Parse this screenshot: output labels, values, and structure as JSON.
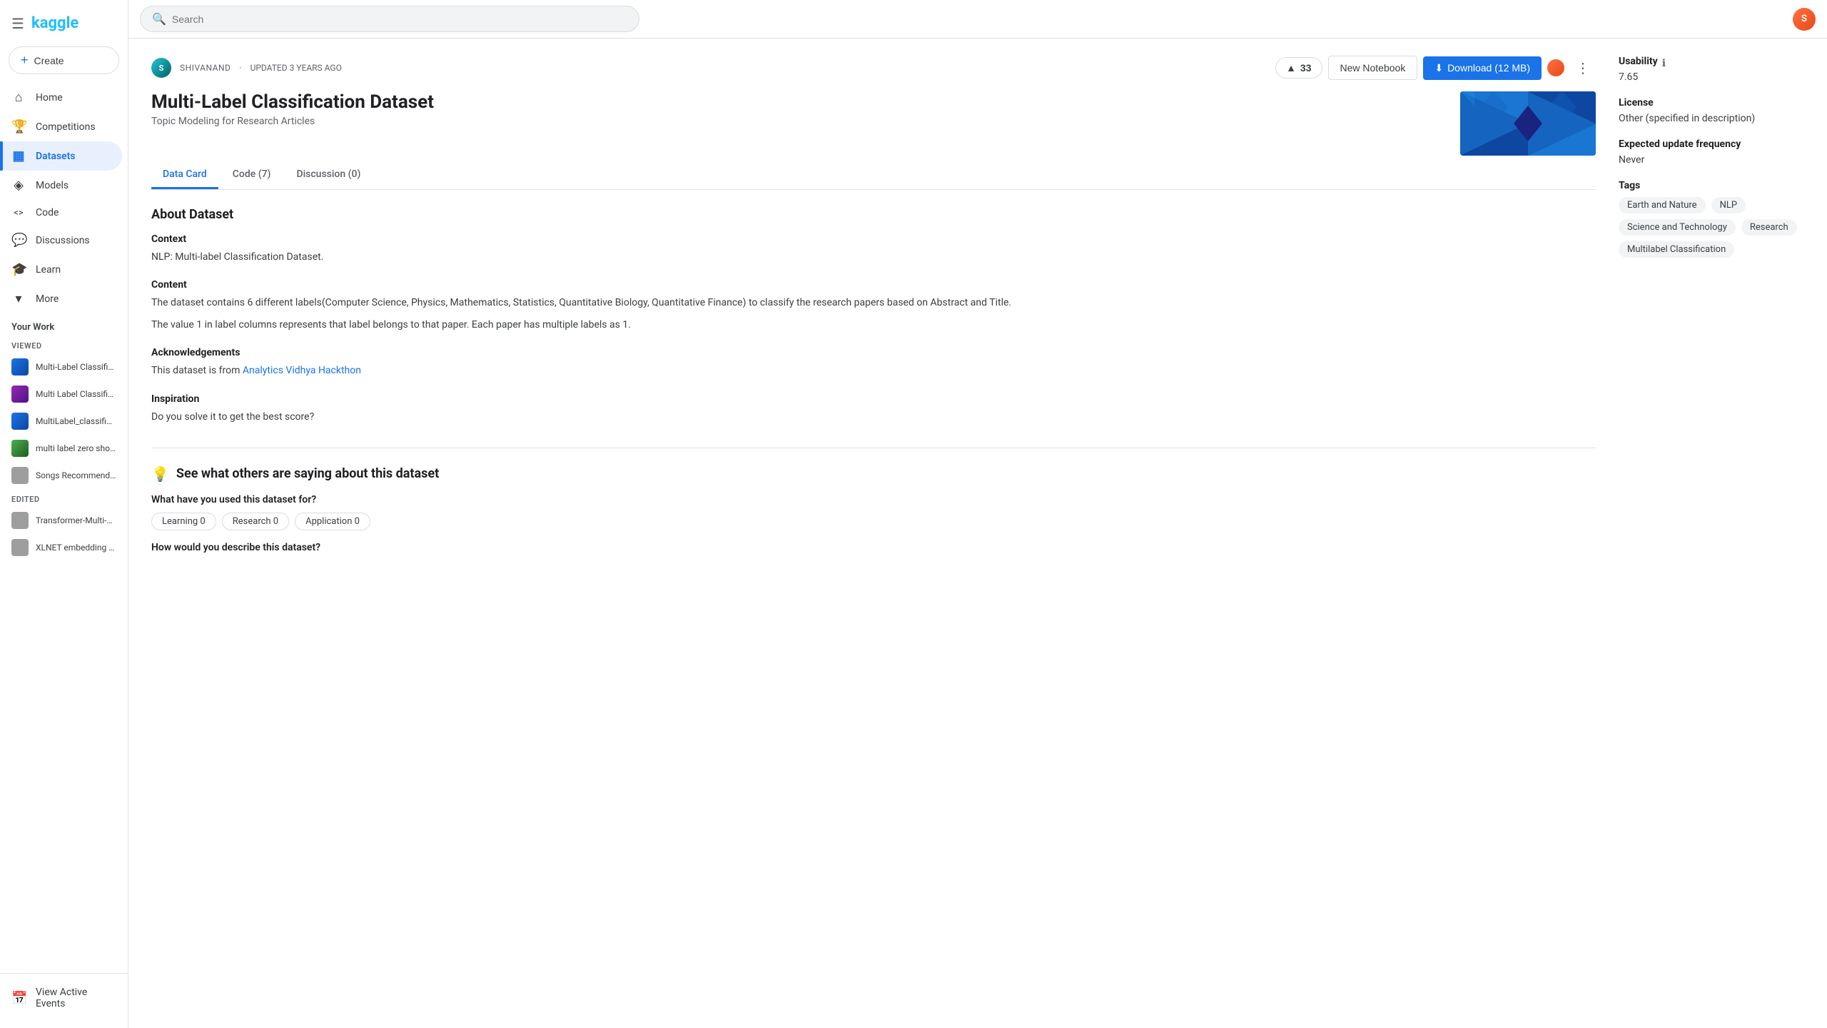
{
  "sidebar": {
    "logo": "kaggle",
    "hamburger": "☰",
    "create_label": "Create",
    "nav_items": [
      {
        "id": "home",
        "label": "Home",
        "icon": "⌂"
      },
      {
        "id": "competitions",
        "label": "Competitions",
        "icon": "🏆"
      },
      {
        "id": "datasets",
        "label": "Datasets",
        "icon": "▦"
      },
      {
        "id": "models",
        "label": "Models",
        "icon": "◈"
      },
      {
        "id": "code",
        "label": "Code",
        "icon": "<>"
      },
      {
        "id": "discussions",
        "label": "Discussions",
        "icon": "💬"
      },
      {
        "id": "learn",
        "label": "Learn",
        "icon": "🎓"
      },
      {
        "id": "more",
        "label": "More",
        "icon": "▾"
      }
    ],
    "your_work_label": "Your Work",
    "viewed_label": "VIEWED",
    "viewed_items": [
      {
        "label": "Multi-Label Classificati...",
        "color": "blue"
      },
      {
        "label": "Multi Label Classifier - ...",
        "color": "purple"
      },
      {
        "label": "MultiLabel_classificati...",
        "color": "blue"
      },
      {
        "label": "multi label zero shot cl...",
        "color": "green"
      },
      {
        "label": "Songs Recommendatio...",
        "color": "gray"
      }
    ],
    "edited_label": "EDITED",
    "edited_items": [
      {
        "label": "Transformer-Multi-Lab...",
        "color": "gray"
      },
      {
        "label": "XLNET embedding and...",
        "color": "gray"
      }
    ],
    "view_active_events": "View Active Events"
  },
  "topbar": {
    "search_placeholder": "Search",
    "user_initials": "S"
  },
  "dataset": {
    "author": "SHIVANAND",
    "updated": "UPDATED 3 YEARS AGO",
    "vote_count": "33",
    "title": "Multi-Label Classification Dataset",
    "subtitle": "Topic Modeling for Research Articles",
    "new_notebook_label": "New Notebook",
    "download_label": "Download (12 MB)",
    "tabs": [
      {
        "id": "data-card",
        "label": "Data Card",
        "active": true
      },
      {
        "id": "code",
        "label": "Code (7)",
        "active": false
      },
      {
        "id": "discussion",
        "label": "Discussion (0)",
        "active": false
      }
    ],
    "about_title": "About Dataset",
    "context_title": "Context",
    "context_text": "NLP: Multi-label Classification Dataset.",
    "content_title": "Content",
    "content_text": "The dataset contains 6 different labels(Computer Science, Physics, Mathematics, Statistics, Quantitative Biology, Quantitative Finance) to classify the research papers based on Abstract and Title.",
    "content_text2": "The value 1 in label columns represents that label belongs to that paper. Each paper has multiple labels as 1.",
    "acknowledgements_title": "Acknowledgements",
    "acknowledgements_text": "This dataset is from ",
    "acknowledgements_link": "Analytics Vidhya Hackthon",
    "inspiration_title": "Inspiration",
    "inspiration_text": "Do you solve it to get the best score?"
  },
  "side_panel": {
    "usability_label": "Usability",
    "usability_value": "7.65",
    "license_label": "License",
    "license_value": "Other (specified in description)",
    "update_freq_label": "Expected update frequency",
    "update_freq_value": "Never",
    "tags_label": "Tags",
    "tags": [
      "Earth and Nature",
      "NLP",
      "Science and Technology",
      "Research",
      "Multilabel Classification"
    ]
  },
  "community": {
    "title": "See what others are saying about this dataset",
    "used_for_label": "What have you used this dataset for?",
    "usage_chips": [
      "Learning 0",
      "Research 0",
      "Application 0"
    ],
    "describe_label": "How would you describe this dataset?"
  }
}
